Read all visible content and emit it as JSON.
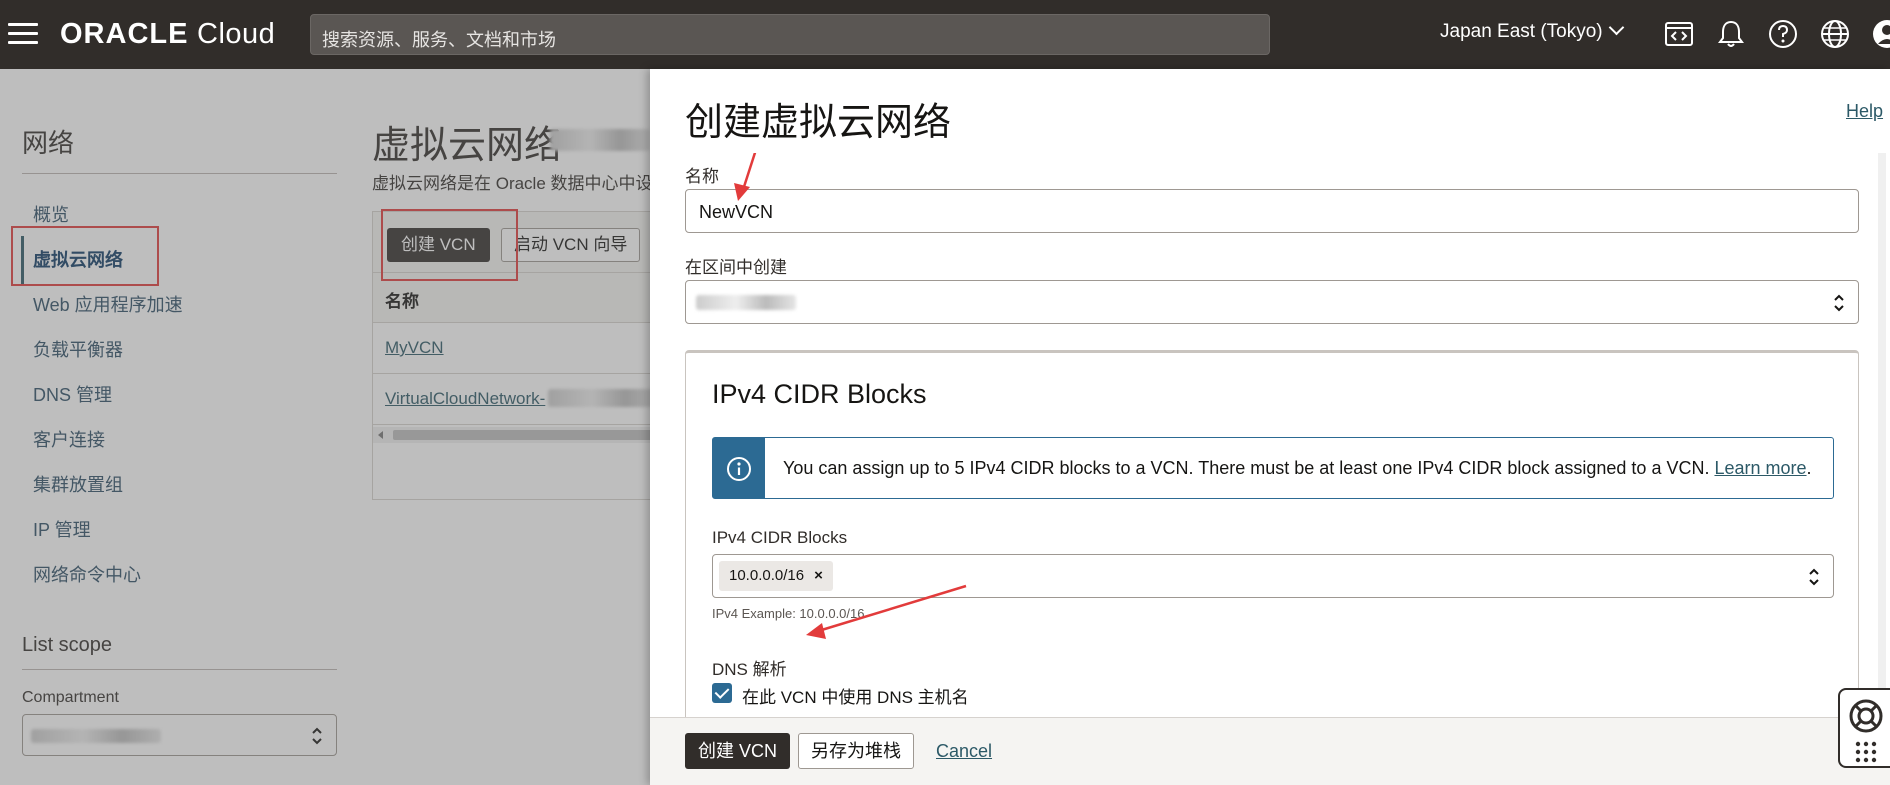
{
  "topbar": {
    "brand_bold": "ORACLE",
    "brand_light": " Cloud",
    "search_placeholder": "搜索资源、服务、文档和市场",
    "region": "Japan East (Tokyo)",
    "icons": [
      "menu-icon",
      "code-editor-icon",
      "bell-icon",
      "help-icon",
      "globe-icon",
      "profile-icon"
    ]
  },
  "leftnav": {
    "heading": "网络",
    "items": [
      {
        "label": "概览"
      },
      {
        "label": "虚拟云网络",
        "active": true
      },
      {
        "label": "Web 应用程序加速"
      },
      {
        "label": "负载平衡器"
      },
      {
        "label": "DNS 管理"
      },
      {
        "label": "客户连接"
      },
      {
        "label": "集群放置组"
      },
      {
        "label": "IP 管理"
      },
      {
        "label": "网络命令中心"
      }
    ],
    "scope_heading": "List scope",
    "compartment_label": "Compartment"
  },
  "content": {
    "title": "虚拟云网络",
    "description": "虚拟云网络是在 Oracle 数据中心中设",
    "create_button": "创建 VCN",
    "wizard_button": "启动 VCN 向导",
    "table_header": "名称",
    "rows": [
      "MyVCN",
      "VirtualCloudNetwork-"
    ]
  },
  "panel": {
    "title": "创建虚拟云网络",
    "help": "Help",
    "name_label": "名称",
    "name_value": "NewVCN",
    "compartment_label": "在区间中创建",
    "cidr_section_title": "IPv4 CIDR Blocks",
    "info_text": "You can assign up to 5 IPv4 CIDR blocks to a VCN. There must be at least one IPv4 CIDR block assigned to a VCN. ",
    "info_link": "Learn more",
    "info_period": ".",
    "cidr_label": "IPv4 CIDR Blocks",
    "cidr_chip": "10.0.0.0/16",
    "cidr_hint": "IPv4 Example: 10.0.0.0/16",
    "dns_label": "DNS 解析",
    "dns_checkbox_label": "在此 VCN 中使用 DNS 主机名",
    "dns_checked": true
  },
  "footer": {
    "create_button": "创建 VCN",
    "save_stack_button": "另存为堆栈",
    "cancel": "Cancel"
  },
  "colors": {
    "topbar": "#312d2a",
    "link": "#2c5967",
    "info_accent": "#2c6a93",
    "annotation": "#e23b3b"
  }
}
